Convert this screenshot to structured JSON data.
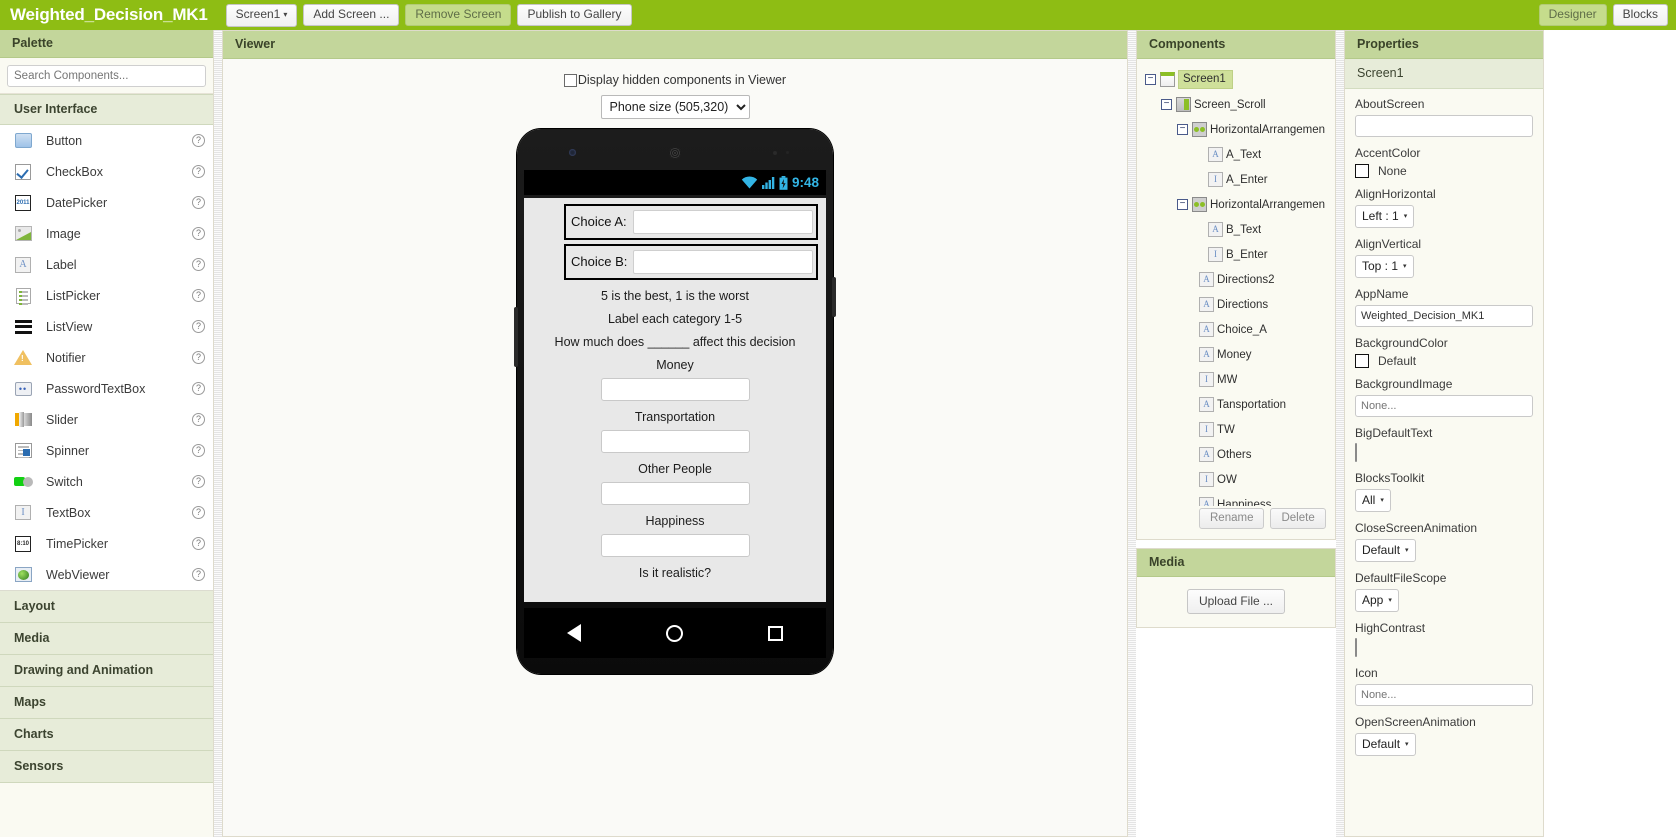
{
  "topbar": {
    "app_title": "Weighted_Decision_MK1",
    "screen_select": "Screen1",
    "add_screen": "Add Screen ...",
    "remove_screen": "Remove Screen",
    "publish": "Publish to Gallery",
    "designer": "Designer",
    "blocks": "Blocks",
    "accent_green": "#8ebd14"
  },
  "palette": {
    "header": "Palette",
    "search_placeholder": "Search Components...",
    "categories": [
      {
        "label": "User Interface",
        "expanded": true
      },
      {
        "label": "Layout",
        "expanded": false
      },
      {
        "label": "Media",
        "expanded": false
      },
      {
        "label": "Drawing and Animation",
        "expanded": false
      },
      {
        "label": "Maps",
        "expanded": false
      },
      {
        "label": "Charts",
        "expanded": false
      },
      {
        "label": "Sensors",
        "expanded": false
      }
    ],
    "user_interface_items": [
      {
        "label": "Button",
        "icon": "button-icon",
        "help": "?"
      },
      {
        "label": "CheckBox",
        "icon": "checkbox-icon",
        "help": "?"
      },
      {
        "label": "DatePicker",
        "icon": "datepicker-icon",
        "help": "?"
      },
      {
        "label": "Image",
        "icon": "image-icon",
        "help": "?"
      },
      {
        "label": "Label",
        "icon": "label-icon",
        "help": "?"
      },
      {
        "label": "ListPicker",
        "icon": "listpicker-icon",
        "help": "?"
      },
      {
        "label": "ListView",
        "icon": "listview-icon",
        "help": "?"
      },
      {
        "label": "Notifier",
        "icon": "notifier-icon",
        "help": "?"
      },
      {
        "label": "PasswordTextBox",
        "icon": "password-icon",
        "help": "?"
      },
      {
        "label": "Slider",
        "icon": "slider-icon",
        "help": "?"
      },
      {
        "label": "Spinner",
        "icon": "spinner-icon",
        "help": "?"
      },
      {
        "label": "Switch",
        "icon": "switch-icon",
        "help": "?"
      },
      {
        "label": "TextBox",
        "icon": "textbox-icon",
        "help": "?"
      },
      {
        "label": "TimePicker",
        "icon": "timepicker-icon",
        "help": "?"
      },
      {
        "label": "WebViewer",
        "icon": "webviewer-icon",
        "help": "?"
      }
    ]
  },
  "viewer": {
    "header": "Viewer",
    "hidden_components_label": "Display hidden components in Viewer",
    "hidden_components_checked": false,
    "size_option": "Phone size (505,320)",
    "phone": {
      "status_time": "9:48",
      "rows": [
        {
          "label": "Choice A:",
          "value": ""
        },
        {
          "label": "Choice B:",
          "value": ""
        }
      ],
      "texts": [
        "5 is the best, 1 is the worst",
        "Label each category 1-5",
        "How much does ______ affect this decision"
      ],
      "categories": [
        {
          "label": "Money",
          "value": ""
        },
        {
          "label": "Transportation",
          "value": ""
        },
        {
          "label": "Other People",
          "value": ""
        },
        {
          "label": "Happiness",
          "value": ""
        }
      ],
      "partial_text": "Is it realistic?"
    }
  },
  "components": {
    "header": "Components",
    "tree": [
      {
        "label": "Screen1",
        "depth": 0,
        "icon": "screen-icon",
        "expander": "minus",
        "selected": true
      },
      {
        "label": "Screen_Scroll",
        "depth": 1,
        "icon": "vertical-scroll-arrangement-icon",
        "expander": "minus",
        "selected": false
      },
      {
        "label": "HorizontalArrangemen",
        "depth": 2,
        "icon": "horizontal-arrangement-icon",
        "expander": "minus",
        "selected": false
      },
      {
        "label": "A_Text",
        "depth": 3,
        "icon": "label-icon",
        "expander": "none",
        "selected": false
      },
      {
        "label": "A_Enter",
        "depth": 3,
        "icon": "textbox-icon",
        "expander": "none",
        "selected": false
      },
      {
        "label": "HorizontalArrangemen",
        "depth": 2,
        "icon": "horizontal-arrangement-icon",
        "expander": "minus",
        "selected": false
      },
      {
        "label": "B_Text",
        "depth": 3,
        "icon": "label-icon",
        "expander": "none",
        "selected": false
      },
      {
        "label": "B_Enter",
        "depth": 3,
        "icon": "textbox-icon",
        "expander": "none",
        "selected": false
      },
      {
        "label": "Directions2",
        "depth": 2,
        "icon": "label-icon",
        "expander": "none",
        "selected": false
      },
      {
        "label": "Directions",
        "depth": 2,
        "icon": "label-icon",
        "expander": "none",
        "selected": false
      },
      {
        "label": "Choice_A",
        "depth": 2,
        "icon": "label-icon",
        "expander": "none",
        "selected": false
      },
      {
        "label": "Money",
        "depth": 2,
        "icon": "label-icon",
        "expander": "none",
        "selected": false
      },
      {
        "label": "MW",
        "depth": 2,
        "icon": "textbox-icon",
        "expander": "none",
        "selected": false
      },
      {
        "label": "Tansportation",
        "depth": 2,
        "icon": "label-icon",
        "expander": "none",
        "selected": false
      },
      {
        "label": "TW",
        "depth": 2,
        "icon": "textbox-icon",
        "expander": "none",
        "selected": false
      },
      {
        "label": "Others",
        "depth": 2,
        "icon": "label-icon",
        "expander": "none",
        "selected": false
      },
      {
        "label": "OW",
        "depth": 2,
        "icon": "textbox-icon",
        "expander": "none",
        "selected": false
      },
      {
        "label": "Happiness",
        "depth": 2,
        "icon": "label-icon",
        "expander": "none",
        "selected": false
      }
    ],
    "rename_button": "Rename",
    "delete_button": "Delete"
  },
  "media": {
    "header": "Media",
    "upload_button": "Upload File ..."
  },
  "properties": {
    "header": "Properties",
    "subject": "Screen1",
    "items": [
      {
        "name": "AboutScreen",
        "kind": "text",
        "value": "",
        "placeholder": ""
      },
      {
        "name": "AccentColor",
        "kind": "color",
        "value": "None"
      },
      {
        "name": "AlignHorizontal",
        "kind": "select",
        "value": "Left : 1"
      },
      {
        "name": "AlignVertical",
        "kind": "select",
        "value": "Top : 1"
      },
      {
        "name": "AppName",
        "kind": "text",
        "value": "Weighted_Decision_MK1",
        "placeholder": ""
      },
      {
        "name": "BackgroundColor",
        "kind": "color",
        "value": "Default"
      },
      {
        "name": "BackgroundImage",
        "kind": "text",
        "value": "",
        "placeholder": "None..."
      },
      {
        "name": "BigDefaultText",
        "kind": "checkbox",
        "value": ""
      },
      {
        "name": "BlocksToolkit",
        "kind": "select",
        "value": "All"
      },
      {
        "name": "CloseScreenAnimation",
        "kind": "select",
        "value": "Default"
      },
      {
        "name": "DefaultFileScope",
        "kind": "select",
        "value": "App"
      },
      {
        "name": "HighContrast",
        "kind": "checkbox",
        "value": ""
      },
      {
        "name": "Icon",
        "kind": "text",
        "value": "",
        "placeholder": "None..."
      },
      {
        "name": "OpenScreenAnimation",
        "kind": "select",
        "value": "Default"
      }
    ]
  }
}
